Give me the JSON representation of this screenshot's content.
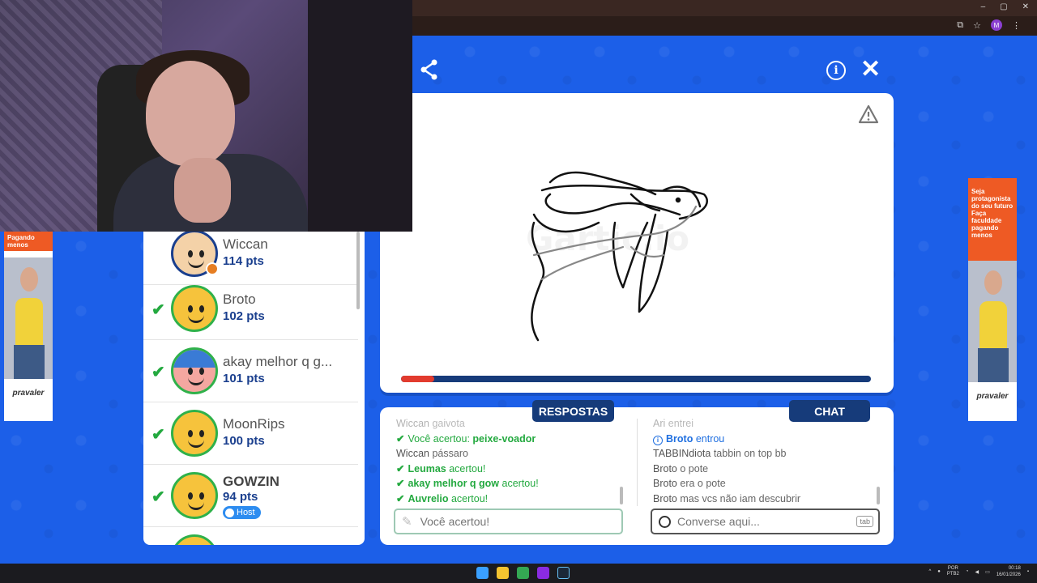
{
  "browser": {
    "window_controls": [
      "–",
      "▢",
      "✕"
    ],
    "profile_initial": "M"
  },
  "webcam": {
    "description_icon": "webcam-feed"
  },
  "header": {
    "share_icon": "share-icon",
    "info_icon": "info-icon",
    "close_icon": "close-icon"
  },
  "canvas": {
    "warning_icon": "warning-icon",
    "watermark": "Gartic.io",
    "progress": 0.07
  },
  "players": [
    {
      "name": "Wiccan",
      "pts": "114 pts",
      "guessed": false,
      "host": false
    },
    {
      "name": "Broto",
      "pts": "102 pts",
      "guessed": true,
      "host": false
    },
    {
      "name": "akay melhor q g...",
      "pts": "101 pts",
      "guessed": true,
      "host": false
    },
    {
      "name": "MoonRips",
      "pts": "100 pts",
      "guessed": true,
      "host": false
    },
    {
      "name": "GOWZIN",
      "pts": "94 pts",
      "guessed": true,
      "host": true,
      "host_label": "Host"
    }
  ],
  "ads": {
    "left": {
      "headline": "Pagando menos",
      "brand": "pravaler"
    },
    "right": {
      "headline": "Seja protagonista do seu futuro Faça faculdade pagando menos",
      "brand": "pravaler"
    }
  },
  "tabs": {
    "answers": "RESPOSTAS",
    "chat": "CHAT"
  },
  "answers": [
    {
      "who": "Wiccan",
      "text": "gaivota",
      "faded": true
    },
    {
      "prefix": "Você acertou:",
      "word": "peixe-voador",
      "ok": true
    },
    {
      "who": "Wiccan",
      "text": "pássaro"
    },
    {
      "who": "Leumas",
      "text": "acertou!",
      "ok": true
    },
    {
      "who": "akay melhor q gow",
      "text": "acertou!",
      "ok": true
    },
    {
      "who": "Auvrelio",
      "text": "acertou!",
      "ok": true
    }
  ],
  "chat": [
    {
      "who": "Ari",
      "text": "entrei",
      "faded": true
    },
    {
      "who": "Broto",
      "text": "entrou",
      "system": true
    },
    {
      "who": "TABBINdiota",
      "text": "tabbin on top bb"
    },
    {
      "who": "Broto",
      "text": "o pote"
    },
    {
      "who": "Broto",
      "text": "era o pote"
    },
    {
      "who": "Broto",
      "text": "mas vcs não iam descubrir"
    }
  ],
  "answer_input": {
    "placeholder": "Você acertou!"
  },
  "chat_input": {
    "placeholder": "Converse aqui...",
    "tab_hint": "tab"
  },
  "taskbar": {
    "lang": "POR",
    "lang2": "PTB2",
    "time": "00:18",
    "date": "16/01/2026"
  }
}
